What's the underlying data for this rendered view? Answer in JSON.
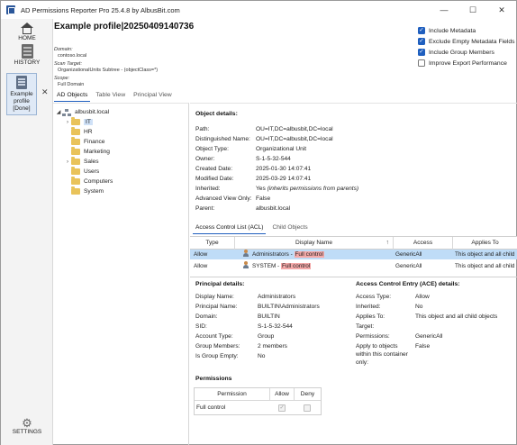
{
  "window": {
    "title": "AD Permissions Reporter Pro 25.4.8 by AlbusBit.com",
    "controls": {
      "minimize": "—",
      "maximize": "☐",
      "close": "✕"
    }
  },
  "nav": {
    "home": "HOME",
    "history": "HISTORY",
    "profile_lines": [
      "Example",
      "profile",
      "[Done]"
    ],
    "profile_close": "✕",
    "settings": "SETTINGS"
  },
  "header": {
    "title": "Example profile|20250409140736",
    "domain_label": "Domain:",
    "domain_value": "contoso.local",
    "scan_target_label": "Scan Target:",
    "scan_target_value": "OrganizationalUnits Subtree - (objectClass=*)",
    "scope_label": "Scope:",
    "scope_value": "Full Domain"
  },
  "options": [
    {
      "label": "Include Metadata",
      "checked": true
    },
    {
      "label": "Exclude Empty Metadata Fields",
      "checked": true
    },
    {
      "label": "Include Group Members",
      "checked": true
    },
    {
      "label": "Improve Export Performance",
      "checked": false
    }
  ],
  "tabs": [
    "AD Objects",
    "Table View",
    "Principal View"
  ],
  "tree": {
    "root": "albusbit.local",
    "children": [
      "IT",
      "HR",
      "Finance",
      "Marketing",
      "Sales",
      "Users",
      "Computers",
      "System"
    ]
  },
  "object_details": {
    "title": "Object details:",
    "rows": [
      {
        "label": "Path:",
        "value": "OU=IT,DC=albusbit,DC=local"
      },
      {
        "label": "Distinguished Name:",
        "value": "OU=IT,DC=albusbit,DC=local"
      },
      {
        "label": "Object Type:",
        "value": "Organizational Unit"
      },
      {
        "label": "Owner:",
        "value": "S-1-5-32-544"
      },
      {
        "label": "Created Date:",
        "value": "2025-01-30 14:07:41"
      },
      {
        "label": "Modified Date:",
        "value": "2025-03-29 14:07:41"
      },
      {
        "label": "Inherited:",
        "value": "Yes",
        "note": "(inherits permissions from parents)"
      },
      {
        "label": "Advanced View Only:",
        "value": "False"
      },
      {
        "label": "Parent:",
        "value": "albusbit.local"
      }
    ]
  },
  "subtabs": [
    "Access Control List (ACL)",
    "Child Objects"
  ],
  "acl": {
    "headers": [
      "Type",
      "Display Name",
      "Access",
      "Applies To"
    ],
    "sort_indicator": "↑",
    "rows": [
      {
        "type": "Allow",
        "name": "Administrators",
        "sep": " - ",
        "rights": "Full control",
        "access": "GenericAll",
        "applies": "This object and all child"
      },
      {
        "type": "Allow",
        "name": "SYSTEM",
        "sep": " - ",
        "rights": "Full control",
        "access": "GenericAll",
        "applies": "This object and all child"
      }
    ]
  },
  "principal_details": {
    "title": "Principal details:",
    "rows": [
      {
        "label": "Display Name:",
        "value": "Administrators"
      },
      {
        "label": "Principal Name:",
        "value": "BUILTIN\\Administrators"
      },
      {
        "label": "Domain:",
        "value": "BUILTIN"
      },
      {
        "label": "SID:",
        "value": "S-1-5-32-544"
      },
      {
        "label": "Account Type:",
        "value": "Group"
      },
      {
        "label": "Group Members:",
        "value": "2 members"
      },
      {
        "label": "Is Group Empty:",
        "value": "No"
      }
    ]
  },
  "ace_details": {
    "title": "Access Control Entry (ACE) details:",
    "rows": [
      {
        "label": "Access Type:",
        "value": "Allow"
      },
      {
        "label": "Inherited:",
        "value": "No"
      },
      {
        "label": "Applies To:",
        "value": "This object and all child objects"
      },
      {
        "label": "Target:",
        "value": ""
      },
      {
        "label": "Permissions:",
        "value": "GenericAll"
      },
      {
        "label": "Apply to objects",
        "value": "False"
      },
      {
        "label": "within this container",
        "value": ""
      },
      {
        "label": "only:",
        "value": ""
      }
    ]
  },
  "permissions": {
    "title": "Permissions",
    "headers": [
      "Permission",
      "Allow",
      "Deny"
    ],
    "rows": [
      {
        "permission": "Full control",
        "allow": true,
        "deny": false
      }
    ]
  },
  "colors": {
    "accent": "#1f5fbf",
    "selection": "#bfdcf7",
    "highlight": "#f4a9a9",
    "folder": "#e9c35a"
  }
}
